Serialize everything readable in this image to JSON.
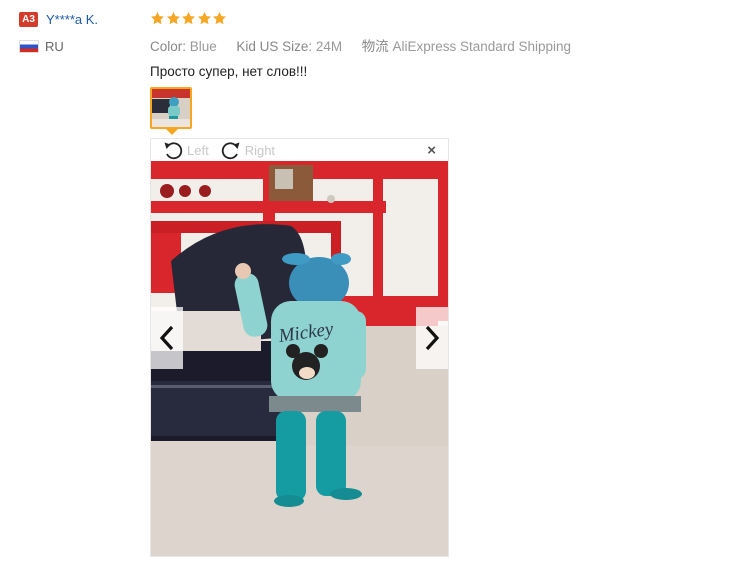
{
  "user": {
    "level_badge": "A3",
    "name": "Y****a K.",
    "country_code": "RU"
  },
  "review": {
    "rating": 5,
    "color_label": "Color:",
    "color_value": "Blue",
    "size_label": "Kid US Size:",
    "size_value": "24M",
    "logistics_label": "物流",
    "logistics_value": "AliExpress Standard Shipping",
    "text": "Просто супер, нет слов!!!"
  },
  "viewer": {
    "rotate_left_label": "Left",
    "rotate_right_label": "Right",
    "close_label": "×"
  },
  "colors": {
    "star": "#f5a623",
    "thumb_border": "#f5a623",
    "username": "#1e5aa8",
    "badge": "#d23c2b"
  },
  "icons": {
    "rotate_left": "rotate-left-icon",
    "rotate_right": "rotate-right-icon",
    "prev": "chevron-left-icon",
    "next": "chevron-right-icon",
    "close": "close-icon",
    "star": "star-icon",
    "flag": "russia-flag-icon"
  }
}
